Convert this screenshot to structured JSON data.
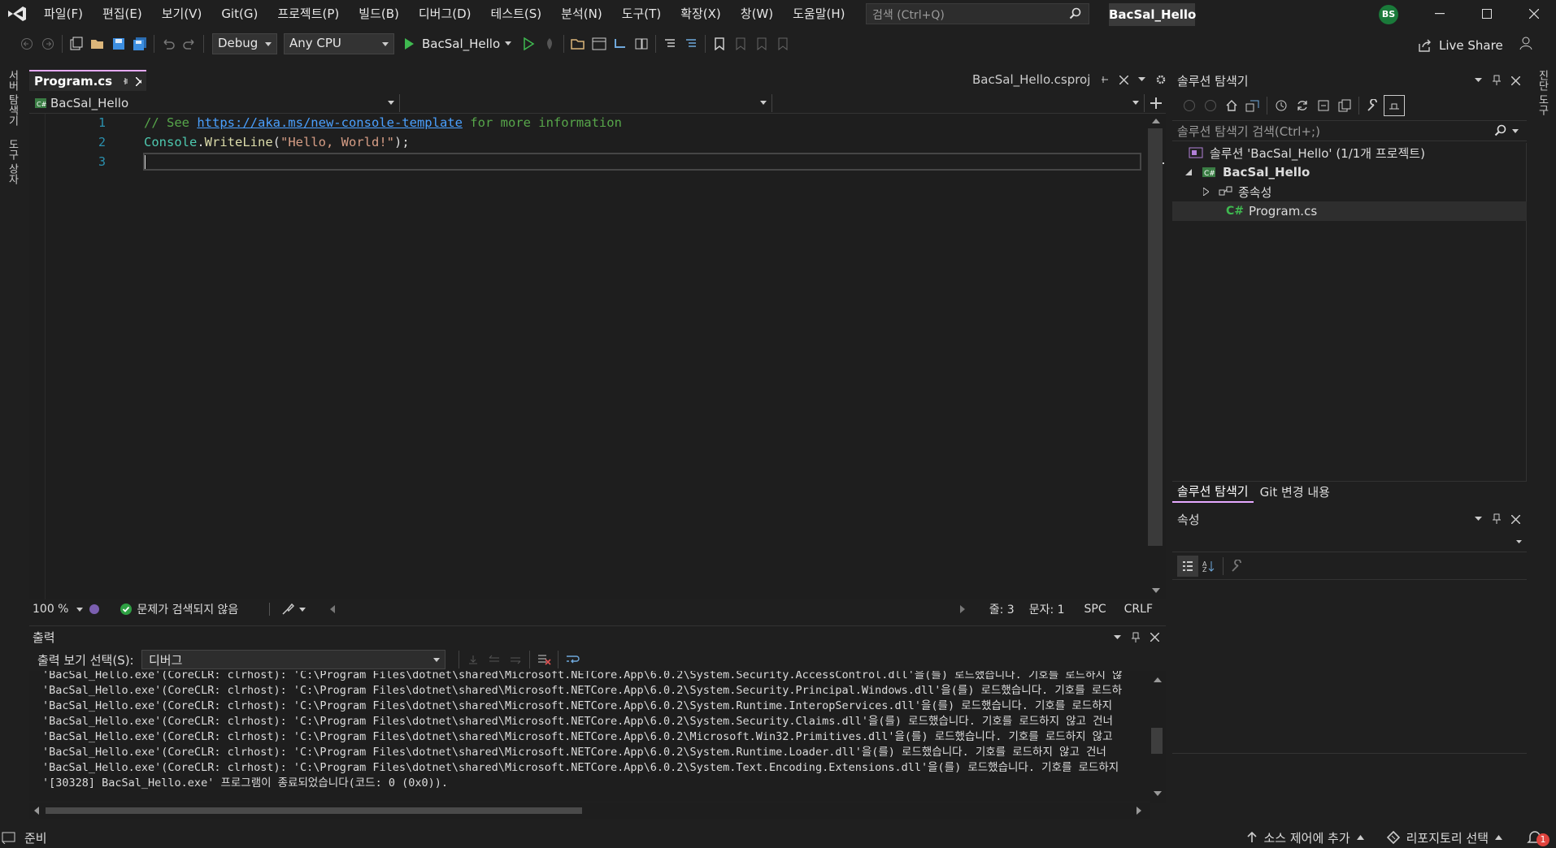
{
  "menu": [
    "파일(F)",
    "편집(E)",
    "보기(V)",
    "Git(G)",
    "프로젝트(P)",
    "빌드(B)",
    "디버그(D)",
    "테스트(S)",
    "분석(N)",
    "도구(T)",
    "확장(X)",
    "창(W)",
    "도움말(H)"
  ],
  "search": {
    "placeholder": "검색 (Ctrl+Q)"
  },
  "solution_title": "BacSal_Hello",
  "user_initials": "BS",
  "toolbar": {
    "config": "Debug",
    "platform": "Any CPU",
    "run_target": "BacSal_Hello",
    "live_share": "Live Share"
  },
  "left_rail": {
    "server_explorer": "서버 탐색기",
    "toolbox": "도구 상자"
  },
  "right_rail": {
    "label": "진단 도구"
  },
  "editor": {
    "active_tab": "Program.cs",
    "other_tab": "BacSal_Hello.csproj",
    "nav_project": "BacSal_Hello",
    "line_numbers": [
      "1",
      "2",
      "3"
    ],
    "line1": {
      "comment_pre": "// See ",
      "link": "https://aka.ms/new-console-template",
      "comment_post": " for more information"
    },
    "line2": {
      "obj": "Console",
      "dot": ".",
      "method": "WriteLine",
      "open": "(",
      "str": "\"Hello, World!\"",
      "close": ");"
    },
    "zoom": "100 %",
    "issues": "문제가 검색되지 않음",
    "line": "줄: 3",
    "col": "문자: 1",
    "spc": "SPC",
    "crlf": "CRLF"
  },
  "output": {
    "title": "출력",
    "source_label": "출력 보기 선택(S):",
    "source": "디버그",
    "lines": [
      "'BacSal_Hello.exe'(CoreCLR: clrhost): 'C:\\Program Files\\dotnet\\shared\\Microsoft.NETCore.App\\6.0.2\\System.Security.AccessControl.dll'을(를) 로드했습니다. 기호를 로드하지 않",
      "'BacSal_Hello.exe'(CoreCLR: clrhost): 'C:\\Program Files\\dotnet\\shared\\Microsoft.NETCore.App\\6.0.2\\System.Security.Principal.Windows.dll'을(를) 로드했습니다. 기호를 로드하",
      "'BacSal_Hello.exe'(CoreCLR: clrhost): 'C:\\Program Files\\dotnet\\shared\\Microsoft.NETCore.App\\6.0.2\\System.Runtime.InteropServices.dll'을(를) 로드했습니다. 기호를 로드하지",
      "'BacSal_Hello.exe'(CoreCLR: clrhost): 'C:\\Program Files\\dotnet\\shared\\Microsoft.NETCore.App\\6.0.2\\System.Security.Claims.dll'을(를) 로드했습니다. 기호를 로드하지 않고 건너",
      "'BacSal_Hello.exe'(CoreCLR: clrhost): 'C:\\Program Files\\dotnet\\shared\\Microsoft.NETCore.App\\6.0.2\\Microsoft.Win32.Primitives.dll'을(를) 로드했습니다. 기호를 로드하지 않고",
      "'BacSal_Hello.exe'(CoreCLR: clrhost): 'C:\\Program Files\\dotnet\\shared\\Microsoft.NETCore.App\\6.0.2\\System.Runtime.Loader.dll'을(를) 로드했습니다. 기호를 로드하지 않고 건너",
      "'BacSal_Hello.exe'(CoreCLR: clrhost): 'C:\\Program Files\\dotnet\\shared\\Microsoft.NETCore.App\\6.0.2\\System.Text.Encoding.Extensions.dll'을(를) 로드했습니다. 기호를 로드하지",
      "'[30328] BacSal_Hello.exe' 프로그램이 종료되었습니다(코드: 0 (0x0))."
    ]
  },
  "solution_explorer": {
    "title": "솔루션 탐색기",
    "search_placeholder": "솔루션 탐색기 검색(Ctrl+;)",
    "solution": "솔루션 'BacSal_Hello' (1/1개 프로젝트)",
    "project": "BacSal_Hello",
    "dependencies": "종속성",
    "file": "Program.cs",
    "tab_active": "솔루션 탐색기",
    "tab_git": "Git 변경 내용"
  },
  "properties": {
    "title": "속성"
  },
  "status": {
    "ready": "준비",
    "source_control": "소스 제어에 추가",
    "repository": "리포지토리 선택",
    "notification_count": "1"
  },
  "colors": {
    "accent": "#e6a9ff",
    "keyword_comment": "#57a64a",
    "string": "#d69d85",
    "type": "#4ec9b0",
    "method": "#dcdcaa",
    "line_number": "#2b91af",
    "link": "#4aa0ff",
    "ok_green": "#2ea043"
  }
}
